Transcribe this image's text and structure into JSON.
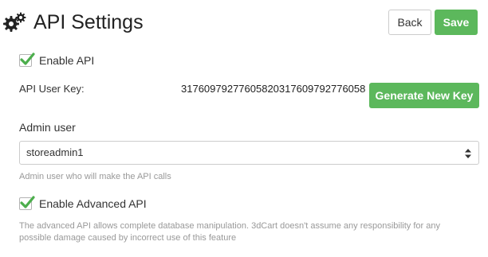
{
  "header": {
    "title": "API Settings",
    "back_label": "Back",
    "save_label": "Save"
  },
  "enable_api": {
    "label": "Enable API",
    "checked": true
  },
  "api_key": {
    "label": "API User Key:",
    "value": "3176097927760582031760979277605​8",
    "generate_label": "Generate New Key"
  },
  "admin_user": {
    "label": "Admin user",
    "selected": "storeadmin1",
    "help": "Admin user who will make the API calls"
  },
  "advanced_api": {
    "label": "Enable Advanced API",
    "checked": true,
    "help_line1": "The advanced API allows complete database manipulation. 3dCart doesn't assume any responsibility for any",
    "help_line2": "possible damage caused by incorrect use of this feature"
  },
  "colors": {
    "accent_green": "#5cb85c",
    "check_green": "#4cae4c",
    "help_text": "#999999"
  },
  "icons": {
    "title_icon": "gears-icon",
    "select_icon": "sort-arrows-icon",
    "check_icon": "checkmark-icon"
  }
}
